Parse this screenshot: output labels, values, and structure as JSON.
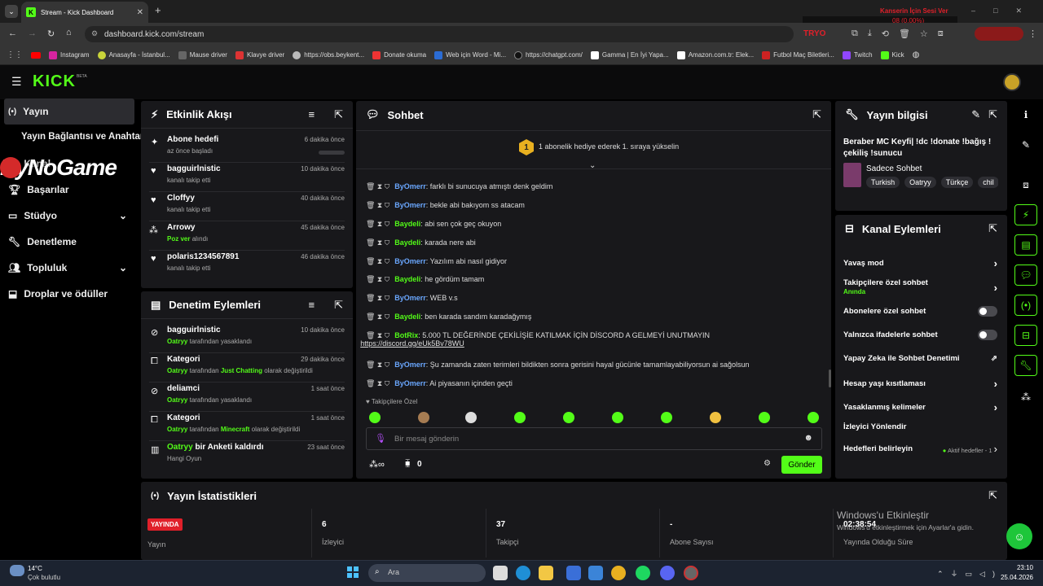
{
  "browser": {
    "tab_title": "Stream - Kick Dashboard",
    "url": "dashboard.kick.com/stream",
    "overlay_text": "Kanserin İçin Sesi Ver",
    "overlay_sub": "08 (0.00%)",
    "bookmarks": [
      "Instagram",
      "Anasayfa - İstanbul...",
      "Mause driver",
      "Klavye driver",
      "https://obs.beykent...",
      "Donate okuma",
      "Web için Word - Mi...",
      "https://chatgpt.com/",
      "Gamma | En İyi Yapa...",
      "Amazon.com.tr: Elek...",
      "Futbol Maç Biletleri...",
      "Twitch",
      "Kick"
    ]
  },
  "header": {
    "logo": "KICK",
    "beta": "BETA"
  },
  "sidebar": {
    "items": [
      {
        "label": "Yayın"
      },
      {
        "label": "Yayın Bağlantısı ve Anahtarı"
      },
      {
        "label": "Kanal"
      },
      {
        "label": "Başarılar"
      },
      {
        "label": "Stüdyo"
      },
      {
        "label": "Denetleme"
      },
      {
        "label": "Topluluk"
      },
      {
        "label": "Droplar ve ödüller"
      }
    ],
    "watermark": "ByNoGame"
  },
  "activity": {
    "title": "Etkinlik Akışı",
    "items": [
      {
        "title": "Abone hedefi",
        "sub": "az önce başladı",
        "time": "6 dakika önce"
      },
      {
        "title": "bagguirlnistic",
        "sub": "kanalı takip etti",
        "time": "10 dakika önce"
      },
      {
        "title": "Cloffyy",
        "sub": "kanalı takip etti",
        "time": "40 dakika önce"
      },
      {
        "title": "Arrowy",
        "sub_highlight": "Poz ver",
        "sub": "alındı",
        "time": "45 dakika önce"
      },
      {
        "title": "polaris1234567891",
        "sub": "kanalı takip etti",
        "time": "46 dakika önce"
      }
    ]
  },
  "mod": {
    "title": "Denetim Eylemleri",
    "items": [
      {
        "title": "bagguirlnistic",
        "user": "Oatryy",
        "sub": "tarafından yasaklandı",
        "time": "10 dakika önce"
      },
      {
        "title": "Kategori",
        "user": "Oatryy",
        "sub": "tarafından",
        "target": "Just Chatting",
        "sub2": "olarak değiştirildi",
        "time": "29 dakika önce"
      },
      {
        "title": "deliamci",
        "user": "Oatryy",
        "sub": "tarafından yasaklandı",
        "time": "1 saat önce"
      },
      {
        "title": "Kategori",
        "user": "Oatryy",
        "sub": "tarafından",
        "target": "Minecraft",
        "sub2": "olarak değiştirildi",
        "time": "1 saat önce"
      },
      {
        "title_user": "Oatryy",
        "title": "bir Anketi kaldırdı",
        "sub_plain": "Hangi Oyun",
        "time": "23 saat önce"
      }
    ]
  },
  "chat": {
    "title": "Sohbet",
    "pin_badge": "1",
    "pin_text": "1 abonelik hediye ederek 1. sıraya yükselin",
    "messages": [
      {
        "user": "ByOmerr",
        "color": "blue",
        "text": "farklı bi sunucuya atmıştı denk geldim"
      },
      {
        "user": "ByOmerr",
        "color": "blue",
        "text": "bekle abi bakıyom ss atacam"
      },
      {
        "user": "Baydeli",
        "color": "green",
        "text": "abi sen çok geç okuyon"
      },
      {
        "user": "Baydeli",
        "color": "green",
        "text": "karada nere abi"
      },
      {
        "user": "ByOmerr",
        "color": "blue",
        "text": "Yazılım abi nasıl gidiyor"
      },
      {
        "user": "Baydeli",
        "color": "green",
        "text": "he gördüm tamam"
      },
      {
        "user": "ByOmerr",
        "color": "blue",
        "text": "WEB v.s"
      },
      {
        "user": "Baydeli",
        "color": "green",
        "text": "ben karada sandım karadağymış"
      },
      {
        "user": "BotRix",
        "color": "green",
        "text": "5.000 TL DEĞERİNDE ÇEKİLİŞİE KATILMAK İÇİN DİSCORD A GELMEYİ UNUTMAYIN",
        "link": "https://discord.gg/eUk5Bv78WU"
      },
      {
        "user": "ByOmerr",
        "color": "blue",
        "text": "Şu zamanda zaten terimleri bildikten sonra gerisini hayal gücünle tamamlayabiliyorsun ai sağolsun"
      },
      {
        "user": "ByOmerr",
        "color": "blue",
        "text": "Ai piyasanın içinden geçti"
      }
    ],
    "followers_only": "Takipçilere Özel",
    "input_placeholder": "Bir mesaj gönderin",
    "points": "0",
    "send": "Gönder"
  },
  "stream_info": {
    "title": "Yayın bilgisi",
    "stream_title": "Beraber MC Keyfi| !dc !donate !bağış ! çekiliş !sunucu",
    "category": "Sadece Sohbet",
    "tags": [
      "Turkish",
      "Oatryy",
      "Türkçe",
      "chil"
    ]
  },
  "channel_actions": {
    "title": "Kanal Eylemleri",
    "items": [
      {
        "label": "Yavaş mod",
        "type": "arrow"
      },
      {
        "label": "Takipçilere özel sohbet",
        "sub": "Anında",
        "type": "arrow"
      },
      {
        "label": "Abonelere özel sohbet",
        "type": "toggle"
      },
      {
        "label": "Yalnızca ifadelerle sohbet",
        "type": "toggle"
      },
      {
        "label": "Yapay Zeka ile Sohbet Denetimi",
        "type": "external"
      },
      {
        "label": "Hesap yaşı kısıtlaması",
        "type": "arrow"
      },
      {
        "label": "Yasaklanmış kelimeler",
        "type": "arrow"
      },
      {
        "label": "İzleyici Yönlendir",
        "type": "none"
      },
      {
        "label": "Hedefleri belirleyin",
        "extra": "Aktif hedefler - 1",
        "type": "arrow"
      }
    ]
  },
  "stats": {
    "title": "Yayın İstatistikleri",
    "live_badge": "YAYINDA",
    "items": [
      {
        "value": "",
        "label": "Yayın"
      },
      {
        "value": "6",
        "label": "İzleyici"
      },
      {
        "value": "37",
        "label": "Takipçi"
      },
      {
        "value": "-",
        "label": "Abone Sayısı"
      },
      {
        "value": "02:38:54",
        "label": "Yayında Olduğu Süre"
      }
    ]
  },
  "windows": {
    "activate_title": "Windows'u Etkinleştir",
    "activate_sub": "Windows'u etkinleştirmek için Ayarlar'a gidin.",
    "weather_temp": "14°C",
    "weather_desc": "Çok bulutlu",
    "search": "Ara",
    "time": "23:10",
    "date": "25.04.2026"
  }
}
